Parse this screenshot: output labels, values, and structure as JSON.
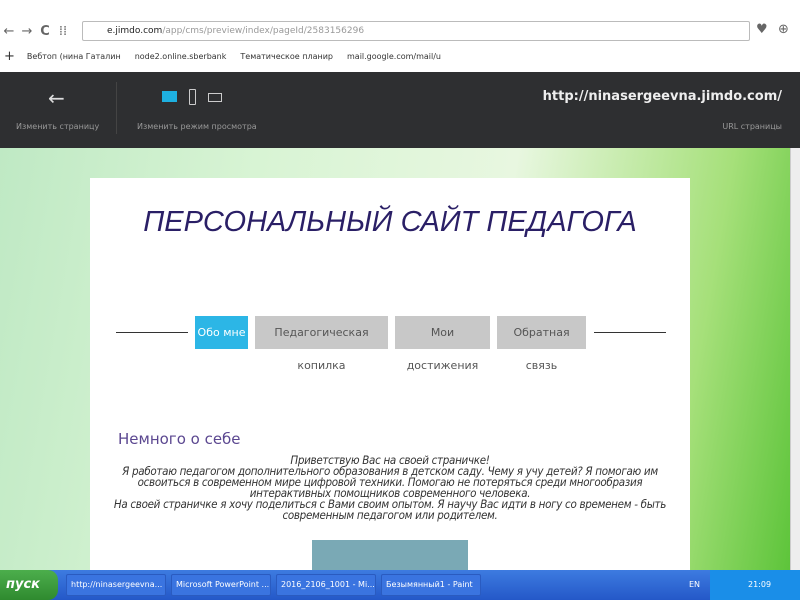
{
  "browser": {
    "url_domain": "e.jimdo.com",
    "url_path": "/app/cms/preview/index/pageId/2583156296",
    "bookmarks": [
      "Вебтоп (нина Гаталин",
      "node2.online.sberbank",
      "Тематическое планир",
      "mail.google.com/mail/u"
    ]
  },
  "jimdo_bar": {
    "edit_page": "Изменить страницу",
    "view_mode": "Изменить режим просмотра",
    "site_url": "http://ninasergeevna.jimdo.com/",
    "url_label": "URL страницы"
  },
  "site": {
    "title": "ПЕРСОНАЛЬНЫЙ САЙТ ПЕДАГОГА",
    "nav": [
      "Обо мне",
      "Педагогическая копилка",
      "Мои достижения",
      "Обратная связь"
    ],
    "heading": "Немного о себе",
    "paragraphs": [
      "Приветствую Вас на своей страничке!",
      "Я работаю педагогом дополнительного образования в детском саду. Чему я учу детей? Я помогаю им освоиться в современном мире цифровой техники. Помогаю не потеряться среди многообразия интерактивных помощников современного человека.",
      "На своей страничке я хочу поделиться с Вами своим опытом. Я научу Вас идти в ногу со временем - быть современным педагогом или родителем."
    ]
  },
  "taskbar": {
    "start": "пуск",
    "items": [
      "http://ninasergeevna...",
      "Microsoft PowerPoint ...",
      "2016_2106_1001 - Mi...",
      "Безымянный1 - Paint"
    ],
    "lang": "EN",
    "time": "21:09"
  }
}
